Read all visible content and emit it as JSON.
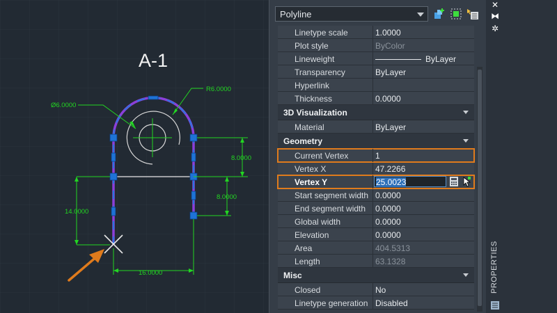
{
  "drawing": {
    "title": "A-1",
    "dims": {
      "dia": "Ø6.0000",
      "radius": "R6.0000",
      "right_upper": "8.0000",
      "right_lower": "8.0000",
      "left_vertical": "14.0000",
      "bottom": "16.0000"
    },
    "colors": {
      "polyline": "#8b3fd9",
      "dimension": "#22d622",
      "grip": "#1e73d6",
      "arrow": "#e07b1c",
      "background": "#222a33"
    }
  },
  "palette": {
    "object_type": "Polyline",
    "vertical_title": "PROPERTIES",
    "general_rows": [
      {
        "label": "Linetype scale",
        "value": "1.0000"
      },
      {
        "label": "Plot style",
        "value": "ByColor",
        "dim": true
      },
      {
        "label": "Lineweight",
        "value": "ByLayer",
        "line": true
      },
      {
        "label": "Transparency",
        "value": "ByLayer"
      },
      {
        "label": "Hyperlink",
        "value": ""
      },
      {
        "label": "Thickness",
        "value": "0.0000"
      }
    ],
    "sections": {
      "viz": "3D Visualization",
      "geometry": "Geometry",
      "misc": "Misc"
    },
    "viz_rows": [
      {
        "label": "Material",
        "value": "ByLayer"
      }
    ],
    "geometry_rows": {
      "current_vertex": {
        "label": "Current Vertex",
        "value": "1"
      },
      "vertex_x": {
        "label": "Vertex X",
        "value": "47.2266"
      },
      "vertex_y": {
        "label": "Vertex Y",
        "value": "25.0023"
      },
      "rest": [
        {
          "label": "Start segment width",
          "value": "0.0000"
        },
        {
          "label": "End segment width",
          "value": "0.0000"
        },
        {
          "label": "Global width",
          "value": "0.0000"
        },
        {
          "label": "Elevation",
          "value": "0.0000"
        },
        {
          "label": "Area",
          "value": "404.5313",
          "dim": true
        },
        {
          "label": "Length",
          "value": "63.1328",
          "dim": true
        }
      ]
    },
    "misc_rows": [
      {
        "label": "Closed",
        "value": "No"
      },
      {
        "label": "Linetype generation",
        "value": "Disabled"
      }
    ]
  }
}
